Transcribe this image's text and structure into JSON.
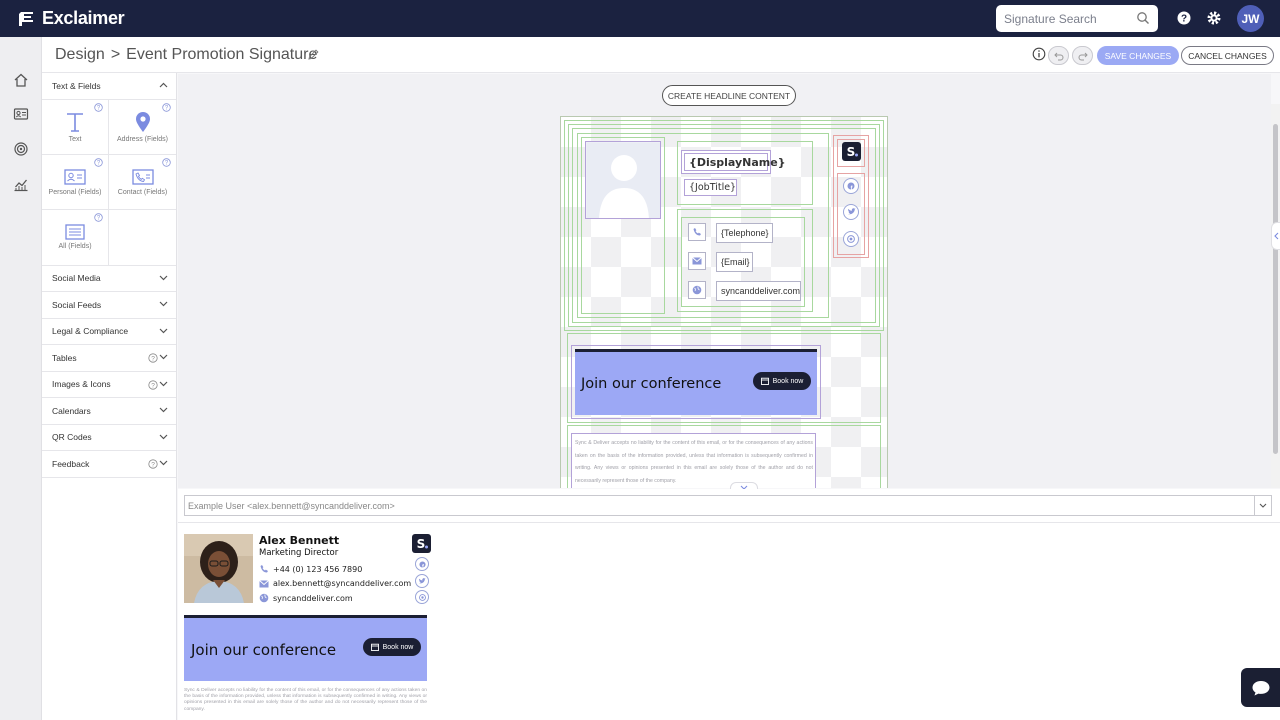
{
  "app": {
    "brand": "Exclaimer"
  },
  "topbar": {
    "search_placeholder": "Signature Search",
    "user_initials": "JW",
    "icons": [
      "search-icon",
      "help-icon",
      "gear-icon"
    ]
  },
  "rail": {
    "icons": [
      "home-icon",
      "contact-card-icon",
      "target-icon",
      "analytics-icon"
    ]
  },
  "header": {
    "breadcrumb_root": "Design",
    "breadcrumb_sep": ">",
    "page_title": "Event Promotion Signature",
    "save_label": "SAVE CHANGES",
    "cancel_label": "CANCEL CHANGES"
  },
  "sidebar": {
    "text_fields_label": "Text & Fields",
    "tiles": [
      {
        "label": "Text",
        "icon": "text-icon"
      },
      {
        "label": "Address (Fields)",
        "icon": "location-pin-icon"
      },
      {
        "label": "Personal (Fields)",
        "icon": "personal-card-icon"
      },
      {
        "label": "Contact (Fields)",
        "icon": "contact-card-icon"
      },
      {
        "label": "All (Fields)",
        "icon": "list-icon"
      }
    ],
    "sections": [
      {
        "label": "Social Media",
        "help": false
      },
      {
        "label": "Social Feeds",
        "help": false
      },
      {
        "label": "Legal & Compliance",
        "help": false
      },
      {
        "label": "Tables",
        "help": true
      },
      {
        "label": "Images & Icons",
        "help": true
      },
      {
        "label": "Calendars",
        "help": false
      },
      {
        "label": "QR Codes",
        "help": false
      },
      {
        "label": "Feedback",
        "help": true
      }
    ]
  },
  "canvas": {
    "headline_button": "CREATE HEADLINE CONTENT",
    "fields": {
      "display_name": "{DisplayName}",
      "job_title": "{JobTitle}",
      "telephone": "{Telephone}",
      "email": "{Email}",
      "website": "syncanddeliver.com"
    },
    "banner_title": "Join our conference",
    "banner_button": "Book now",
    "legal_text": "Sync & Deliver accepts no liability for the content of this email, or for the consequences of any actions taken on the basis of the information provided, unless that information is subsequently confirmed in writing. Any views or opinions presented in this email are solely those of the author and do not necessarily represent those of the company."
  },
  "userbar": {
    "selected_user": "Example User <alex.bennett@syncanddeliver.com>"
  },
  "preview": {
    "name": "Alex Bennett",
    "job_title": "Marketing Director",
    "phone": "+44 (0) 123 456 7890",
    "email": "alex.bennett@syncanddeliver.com",
    "website": "syncanddeliver.com",
    "banner_title": "Join our conference",
    "banner_button": "Book now",
    "legal_text": "Sync & Deliver accepts no liability for the content of this email, or for the consequences of any actions taken on the basis of the information provided, unless that information is subsequently confirmed in writing. Any views or opinions presented in this email are solely those of the author and do not necessarily represent those of the company."
  },
  "colors": {
    "topbar": "#1b2240",
    "accent": "#9ba9f4",
    "banner": "#9ca8f5",
    "dark": "#1b1f33"
  }
}
